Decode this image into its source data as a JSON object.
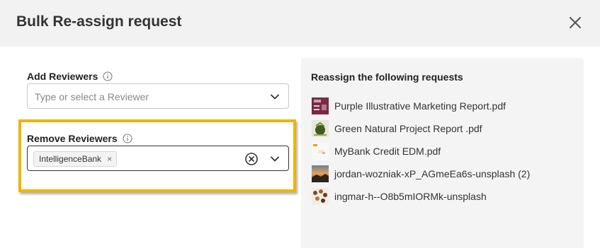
{
  "dialog": {
    "title": "Bulk Re-assign request",
    "close_icon": "close-icon"
  },
  "add_reviewers": {
    "label": "Add Reviewers",
    "placeholder": "Type or select a Reviewer"
  },
  "remove_reviewers": {
    "label": "Remove Reviewers",
    "selected": [
      "IntelligenceBank"
    ],
    "tag_remove_glyph": "×"
  },
  "requests_panel": {
    "title": "Reassign the following requests",
    "items": [
      {
        "name": "Purple Illustrative Marketing Report.pdf",
        "thumb": "purple-report"
      },
      {
        "name": "Green Natural Project Report .pdf",
        "thumb": "green-report"
      },
      {
        "name": "MyBank Credit EDM.pdf",
        "thumb": "mybank-edm"
      },
      {
        "name": "jordan-wozniak-xP_AGmeEa6s-unsplash (2)",
        "thumb": "sunset-photo"
      },
      {
        "name": "ingmar-h--O8b5mIORMk-unsplash",
        "thumb": "leaves-photo"
      }
    ]
  },
  "colors": {
    "highlight": "#f0b400",
    "header_bg": "#f2f2f2",
    "panel_bg": "#f4f4f4"
  }
}
